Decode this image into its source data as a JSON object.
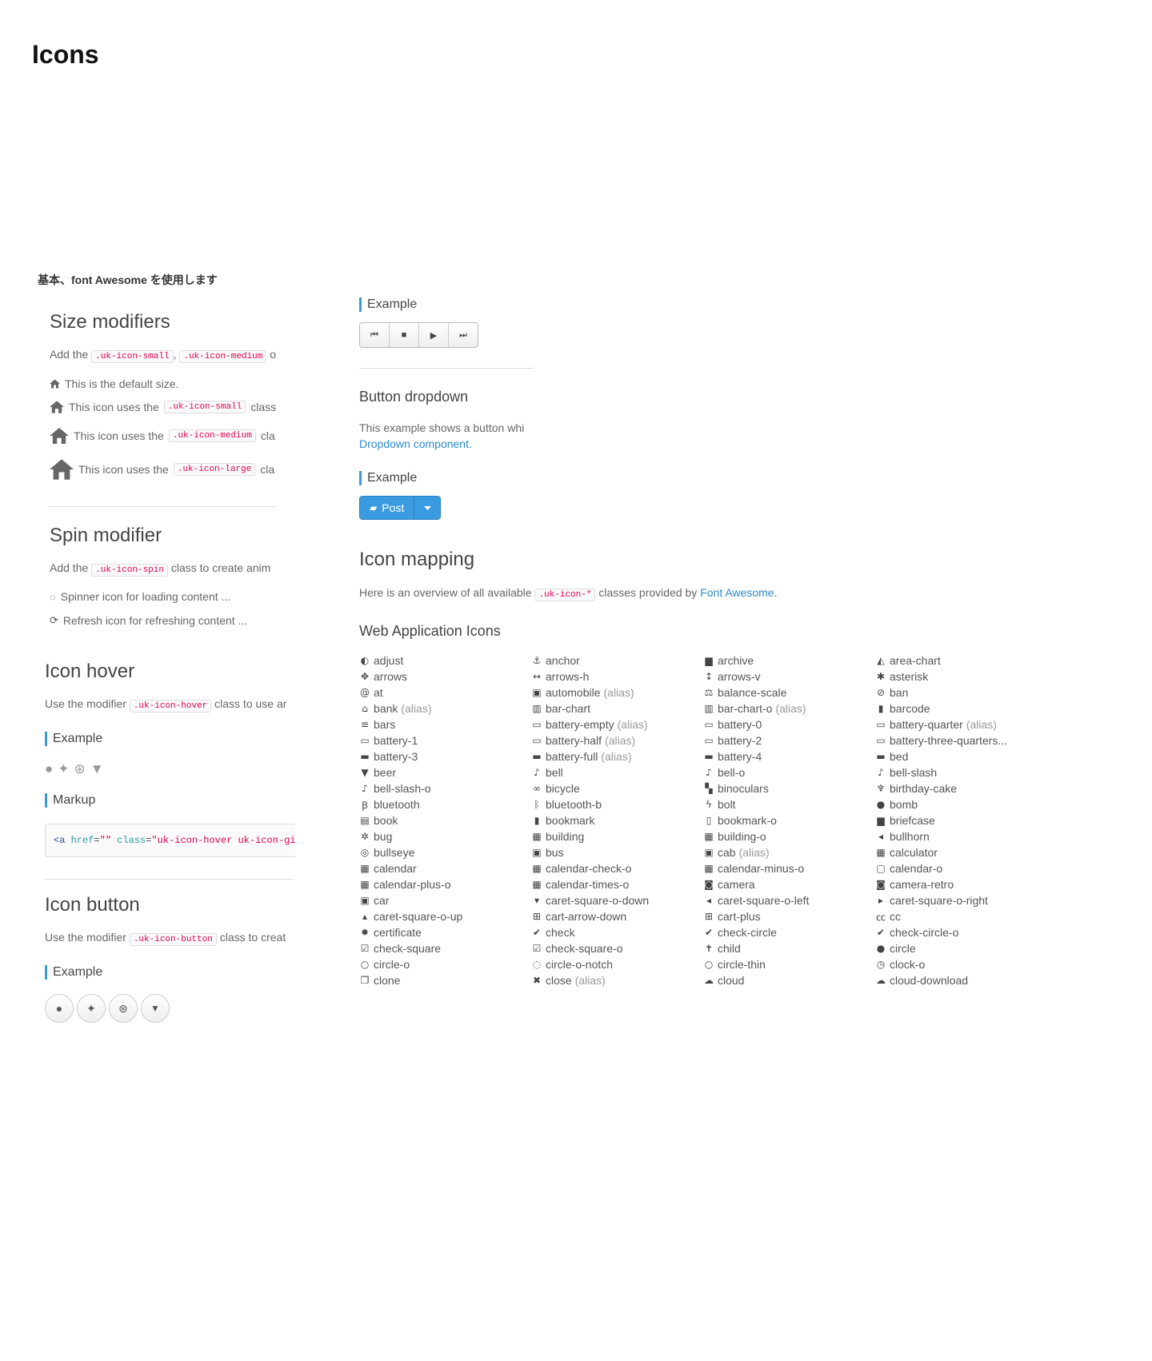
{
  "page_title": "Icons",
  "subtitle": "基本、font Awesome を使用します",
  "size_modifiers": {
    "heading": "Size modifiers",
    "intro_prefix": "Add the",
    "intro_code1": ".uk-icon-small",
    "intro_sep": ",",
    "intro_code2": ".uk-icon-medium",
    "intro_suffix": "o",
    "default_text": "This is the default size.",
    "small_prefix": "This icon uses the",
    "small_code": ".uk-icon-small",
    "small_suffix": "class",
    "medium_prefix": "This icon uses the",
    "medium_code": ".uk-icon-medium",
    "medium_suffix": "cla",
    "large_prefix": "This icon uses the",
    "large_code": ".uk-icon-large",
    "large_suffix": "cla"
  },
  "spin_modifier": {
    "heading": "Spin modifier",
    "intro_prefix": "Add the",
    "intro_code": ".uk-icon-spin",
    "intro_suffix": "class to create anim",
    "spinner_text": "Spinner icon for loading content ...",
    "refresh_text": "Refresh icon for refreshing content ..."
  },
  "icon_hover": {
    "heading": "Icon hover",
    "intro_prefix": "Use the modifier",
    "intro_code": ".uk-icon-hover",
    "intro_suffix": "class to use ar",
    "example_label": "Example",
    "markup_label": "Markup",
    "code_tag_open": "<a",
    "code_attr1": "href",
    "code_eq1": "=",
    "code_val1": "\"\"",
    "code_attr2": "class",
    "code_eq2": "=",
    "code_val2": "\"uk-icon-hover uk-icon-github\"",
    "code_tail": "></"
  },
  "icon_button": {
    "heading": "Icon button",
    "intro_prefix": "Use the modifier",
    "intro_code": ".uk-icon-button",
    "intro_suffix": "class to creat",
    "example_label": "Example"
  },
  "right_top": {
    "example_label": "Example",
    "button_dropdown_heading": "Button dropdown",
    "button_dropdown_text": "This example shows a button whi",
    "dropdown_link": "Dropdown component.",
    "example_label2": "Example",
    "post_label": "Post"
  },
  "icon_mapping": {
    "heading": "Icon mapping",
    "intro_prefix": "Here is an overview of all available",
    "intro_code": ".uk-icon-*",
    "intro_mid": "classes provided by",
    "intro_link": "Font Awesome",
    "intro_end": ".",
    "web_app_heading": "Web Application Icons"
  },
  "colors": {
    "accent": "#3b9be0",
    "code": "#dd0055",
    "link": "#2d8ad1"
  },
  "icons": [
    {
      "glyph": "◐",
      "name": "adjust",
      "alias": ""
    },
    {
      "glyph": "⚓",
      "name": "anchor",
      "alias": ""
    },
    {
      "glyph": "▆",
      "name": "archive",
      "alias": ""
    },
    {
      "glyph": "◭",
      "name": "area-chart",
      "alias": ""
    },
    {
      "glyph": "✥",
      "name": "arrows",
      "alias": ""
    },
    {
      "glyph": "↔",
      "name": "arrows-h",
      "alias": ""
    },
    {
      "glyph": "↕",
      "name": "arrows-v",
      "alias": ""
    },
    {
      "glyph": "✱",
      "name": "asterisk",
      "alias": ""
    },
    {
      "glyph": "@",
      "name": "at",
      "alias": ""
    },
    {
      "glyph": "▣",
      "name": "automobile",
      "alias": "(alias)"
    },
    {
      "glyph": "⚖",
      "name": "balance-scale",
      "alias": ""
    },
    {
      "glyph": "⊘",
      "name": "ban",
      "alias": ""
    },
    {
      "glyph": "⌂",
      "name": "bank",
      "alias": "(alias)"
    },
    {
      "glyph": "▥",
      "name": "bar-chart",
      "alias": ""
    },
    {
      "glyph": "▥",
      "name": "bar-chart-o",
      "alias": "(alias)"
    },
    {
      "glyph": "▮",
      "name": "barcode",
      "alias": ""
    },
    {
      "glyph": "≡",
      "name": "bars",
      "alias": ""
    },
    {
      "glyph": "▭",
      "name": "battery-empty",
      "alias": "(alias)"
    },
    {
      "glyph": "▭",
      "name": "battery-0",
      "alias": ""
    },
    {
      "glyph": "▭",
      "name": "battery-quarter",
      "alias": "(alias)"
    },
    {
      "glyph": "▭",
      "name": "battery-1",
      "alias": ""
    },
    {
      "glyph": "▭",
      "name": "battery-half",
      "alias": "(alias)"
    },
    {
      "glyph": "▭",
      "name": "battery-2",
      "alias": ""
    },
    {
      "glyph": "▭",
      "name": "battery-three-quarters...",
      "alias": ""
    },
    {
      "glyph": "▬",
      "name": "battery-3",
      "alias": ""
    },
    {
      "glyph": "▬",
      "name": "battery-full",
      "alias": "(alias)"
    },
    {
      "glyph": "▬",
      "name": "battery-4",
      "alias": ""
    },
    {
      "glyph": "▬",
      "name": "bed",
      "alias": ""
    },
    {
      "glyph": "▼",
      "name": "beer",
      "alias": ""
    },
    {
      "glyph": "♪",
      "name": "bell",
      "alias": ""
    },
    {
      "glyph": "♪",
      "name": "bell-o",
      "alias": ""
    },
    {
      "glyph": "♪",
      "name": "bell-slash",
      "alias": ""
    },
    {
      "glyph": "♪",
      "name": "bell-slash-o",
      "alias": ""
    },
    {
      "glyph": "∞",
      "name": "bicycle",
      "alias": ""
    },
    {
      "glyph": "▚",
      "name": "binoculars",
      "alias": ""
    },
    {
      "glyph": "♆",
      "name": "birthday-cake",
      "alias": ""
    },
    {
      "glyph": "Ꞵ",
      "name": "bluetooth",
      "alias": ""
    },
    {
      "glyph": "ᛒ",
      "name": "bluetooth-b",
      "alias": ""
    },
    {
      "glyph": "ϟ",
      "name": "bolt",
      "alias": ""
    },
    {
      "glyph": "●",
      "name": "bomb",
      "alias": ""
    },
    {
      "glyph": "▤",
      "name": "book",
      "alias": ""
    },
    {
      "glyph": "▮",
      "name": "bookmark",
      "alias": ""
    },
    {
      "glyph": "▯",
      "name": "bookmark-o",
      "alias": ""
    },
    {
      "glyph": "▆",
      "name": "briefcase",
      "alias": ""
    },
    {
      "glyph": "✲",
      "name": "bug",
      "alias": ""
    },
    {
      "glyph": "▦",
      "name": "building",
      "alias": ""
    },
    {
      "glyph": "▦",
      "name": "building-o",
      "alias": ""
    },
    {
      "glyph": "◂",
      "name": "bullhorn",
      "alias": ""
    },
    {
      "glyph": "◎",
      "name": "bullseye",
      "alias": ""
    },
    {
      "glyph": "▣",
      "name": "bus",
      "alias": ""
    },
    {
      "glyph": "▣",
      "name": "cab",
      "alias": "(alias)"
    },
    {
      "glyph": "▦",
      "name": "calculator",
      "alias": ""
    },
    {
      "glyph": "▦",
      "name": "calendar",
      "alias": ""
    },
    {
      "glyph": "▦",
      "name": "calendar-check-o",
      "alias": ""
    },
    {
      "glyph": "▦",
      "name": "calendar-minus-o",
      "alias": ""
    },
    {
      "glyph": "▢",
      "name": "calendar-o",
      "alias": ""
    },
    {
      "glyph": "▦",
      "name": "calendar-plus-o",
      "alias": ""
    },
    {
      "glyph": "▦",
      "name": "calendar-times-o",
      "alias": ""
    },
    {
      "glyph": "◙",
      "name": "camera",
      "alias": ""
    },
    {
      "glyph": "◙",
      "name": "camera-retro",
      "alias": ""
    },
    {
      "glyph": "▣",
      "name": "car",
      "alias": ""
    },
    {
      "glyph": "▾",
      "name": "caret-square-o-down",
      "alias": ""
    },
    {
      "glyph": "◂",
      "name": "caret-square-o-left",
      "alias": ""
    },
    {
      "glyph": "▸",
      "name": "caret-square-o-right",
      "alias": ""
    },
    {
      "glyph": "▴",
      "name": "caret-square-o-up",
      "alias": ""
    },
    {
      "glyph": "⊞",
      "name": "cart-arrow-down",
      "alias": ""
    },
    {
      "glyph": "⊞",
      "name": "cart-plus",
      "alias": ""
    },
    {
      "glyph": "㏄",
      "name": "cc",
      "alias": ""
    },
    {
      "glyph": "✹",
      "name": "certificate",
      "alias": ""
    },
    {
      "glyph": "✔",
      "name": "check",
      "alias": ""
    },
    {
      "glyph": "✔",
      "name": "check-circle",
      "alias": ""
    },
    {
      "glyph": "✔",
      "name": "check-circle-o",
      "alias": ""
    },
    {
      "glyph": "☑",
      "name": "check-square",
      "alias": ""
    },
    {
      "glyph": "☑",
      "name": "check-square-o",
      "alias": ""
    },
    {
      "glyph": "✝",
      "name": "child",
      "alias": ""
    },
    {
      "glyph": "●",
      "name": "circle",
      "alias": ""
    },
    {
      "glyph": "○",
      "name": "circle-o",
      "alias": ""
    },
    {
      "glyph": "◌",
      "name": "circle-o-notch",
      "alias": ""
    },
    {
      "glyph": "○",
      "name": "circle-thin",
      "alias": ""
    },
    {
      "glyph": "◷",
      "name": "clock-o",
      "alias": ""
    },
    {
      "glyph": "❐",
      "name": "clone",
      "alias": ""
    },
    {
      "glyph": "✖",
      "name": "close",
      "alias": "(alias)"
    },
    {
      "glyph": "☁",
      "name": "cloud",
      "alias": ""
    },
    {
      "glyph": "☁",
      "name": "cloud-download",
      "alias": ""
    }
  ]
}
